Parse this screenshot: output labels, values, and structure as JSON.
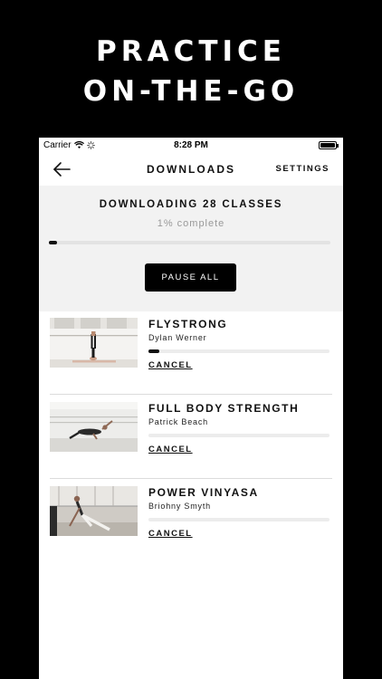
{
  "promo": {
    "line1": "PRACTICE",
    "line2": "ON-THE-GO"
  },
  "status_bar": {
    "carrier": "Carrier",
    "time": "8:28 PM"
  },
  "nav": {
    "title": "DOWNLOADS",
    "settings": "SETTINGS",
    "back_icon": "arrow-left-icon"
  },
  "download_panel": {
    "heading": "DOWNLOADING 28 CLASSES",
    "progress_text": "1% complete",
    "progress": 0.03,
    "pause_label": "PAUSE ALL"
  },
  "classes": [
    {
      "title": "FLYSTRONG",
      "instructor": "Dylan Werner",
      "progress": 0.06,
      "cancel": "CANCEL"
    },
    {
      "title": "FULL BODY STRENGTH",
      "instructor": "Patrick Beach",
      "progress": 0.0,
      "cancel": "CANCEL"
    },
    {
      "title": "POWER VINYASA",
      "instructor": "Briohny Smyth",
      "progress": 0.0,
      "cancel": "CANCEL"
    }
  ],
  "colors": {
    "background": "#000000",
    "panel": "#f2f2f2",
    "accent": "#111111",
    "muted": "#999999"
  }
}
